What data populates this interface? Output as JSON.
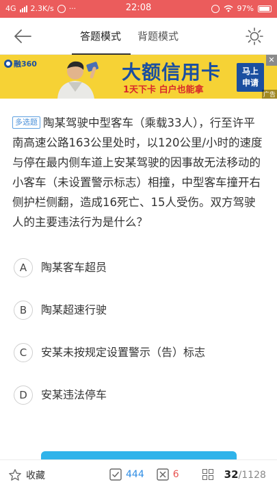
{
  "status_bar": {
    "network": "4G",
    "speed": "2.3K/s",
    "time": "22:08",
    "battery": "97%"
  },
  "header": {
    "tabs": [
      {
        "label": "答题模式",
        "active": true
      },
      {
        "label": "背题模式",
        "active": false
      }
    ],
    "icons": {
      "back": "back-arrow-icon",
      "theme": "sun-icon"
    }
  },
  "ad": {
    "logo_text": "融360",
    "title": "大额信用卡",
    "subtitle": "1天下卡  白户也能拿",
    "apply_line1": "马上",
    "apply_line2": "申请",
    "tag": "广告",
    "colors": {
      "background": "#f6d235",
      "brand": "#1b4fa0",
      "accent": "#d8272b"
    }
  },
  "question": {
    "type_badge": "多选题",
    "text": "陶某驾驶中型客车（乘载33人），行至许平南高速公路163公里处时，以120公里/小时的速度与停在最内侧车道上安某驾驶的因事故无法移动的小客车（未设置警示标志）相撞，中型客车撞开右侧护栏侧翻，造成16死亡、15人受伤。双方驾驶人的主要违法行为是什么？"
  },
  "options": [
    {
      "letter": "A",
      "text": "陶某客车超员"
    },
    {
      "letter": "B",
      "text": "陶某超速行驶"
    },
    {
      "letter": "C",
      "text": "安某未按规定设置警示（告）标志"
    },
    {
      "letter": "D",
      "text": "安某违法停车"
    }
  ],
  "bottom_bar": {
    "favorite_label": "收藏",
    "correct_count": "444",
    "wrong_count": "6",
    "current": "32",
    "total": "/1128",
    "colors": {
      "correct": "#2f8de4",
      "wrong": "#e8524f",
      "next_button": "#2fb3ea"
    }
  }
}
